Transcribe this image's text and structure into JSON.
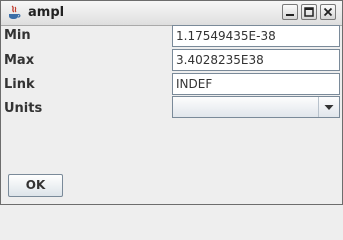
{
  "window": {
    "title": "ampl",
    "app_icon": "java-icon",
    "controls": [
      "minimize-icon",
      "maximize-icon",
      "close-icon"
    ]
  },
  "form": {
    "min_label": "Min",
    "min_value": "1.17549435E-38",
    "max_label": "Max",
    "max_value": "3.4028235E38",
    "link_label": "Link",
    "link_value": "INDEF",
    "units_label": "Units",
    "units_value": ""
  },
  "buttons": {
    "ok_label": "OK"
  }
}
